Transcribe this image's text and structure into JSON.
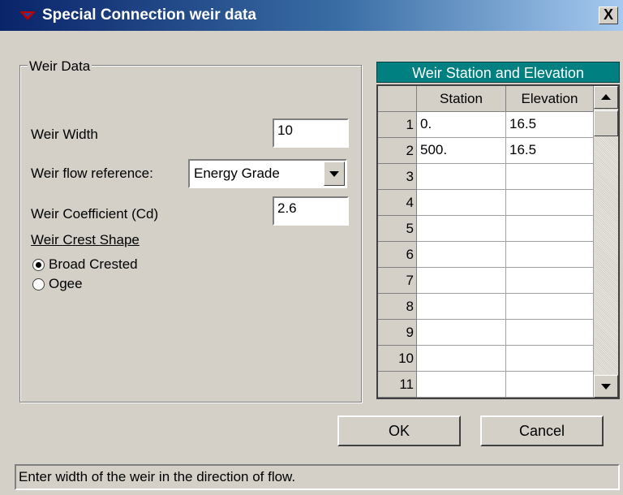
{
  "window": {
    "title": "Special Connection weir data",
    "close_label": "X"
  },
  "weir_data": {
    "group_label": "Weir Data",
    "width_label": "Weir Width",
    "width_value": "10",
    "flow_ref_label": "Weir flow reference:",
    "flow_ref_value": "Energy Grade",
    "coef_label": "Weir Coefficient (Cd)",
    "coef_value": "2.6",
    "crest_label": "Weir Crest Shape",
    "crest_options": [
      {
        "label": "Broad Crested",
        "selected": true
      },
      {
        "label": "Ogee",
        "selected": false
      }
    ]
  },
  "table": {
    "title": "Weir Station and Elevation",
    "headers": [
      "Station",
      "Elevation"
    ],
    "rows": [
      {
        "n": "1",
        "station": "0.",
        "elevation": "16.5"
      },
      {
        "n": "2",
        "station": "500.",
        "elevation": "16.5"
      },
      {
        "n": "3",
        "station": "",
        "elevation": ""
      },
      {
        "n": "4",
        "station": "",
        "elevation": ""
      },
      {
        "n": "5",
        "station": "",
        "elevation": ""
      },
      {
        "n": "6",
        "station": "",
        "elevation": ""
      },
      {
        "n": "7",
        "station": "",
        "elevation": ""
      },
      {
        "n": "8",
        "station": "",
        "elevation": ""
      },
      {
        "n": "9",
        "station": "",
        "elevation": ""
      },
      {
        "n": "10",
        "station": "",
        "elevation": ""
      },
      {
        "n": "11",
        "station": "",
        "elevation": ""
      }
    ]
  },
  "buttons": {
    "ok": "OK",
    "cancel": "Cancel"
  },
  "status": "Enter width of the weir in the direction of flow."
}
